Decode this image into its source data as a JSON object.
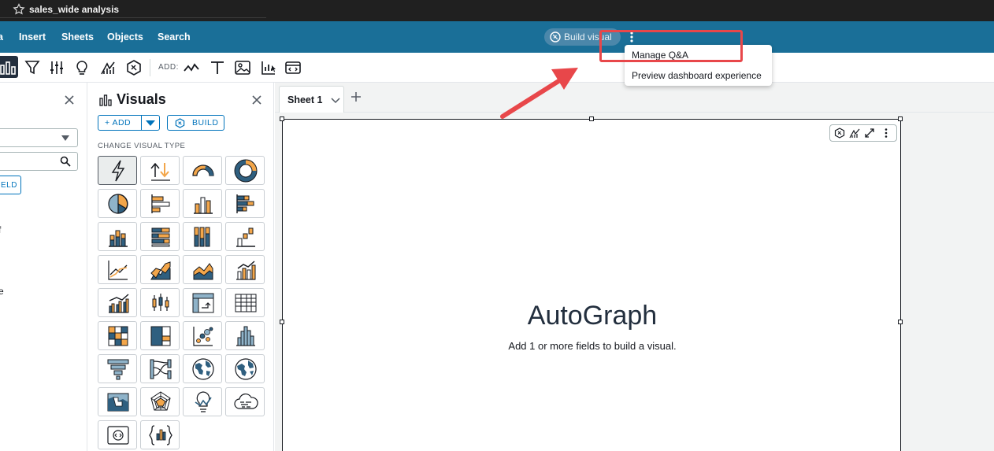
{
  "window": {
    "title": "sales_wide analysis"
  },
  "menubar": {
    "items": [
      {
        "label": "a"
      },
      {
        "label": "Insert"
      },
      {
        "label": "Sheets"
      },
      {
        "label": "Objects"
      },
      {
        "label": "Search"
      }
    ],
    "build_visual_label": "Build visual"
  },
  "toolbar": {
    "add_label": "ADD:"
  },
  "left_panel": {
    "field_button_label": "ELD",
    "fragments": [
      {
        "text": "f"
      },
      {
        "text": "e"
      }
    ]
  },
  "visuals_panel": {
    "title": "Visuals",
    "add_label": "+ ADD",
    "build_label": "BUILD",
    "section_label": "CHANGE VISUAL TYPE",
    "types": [
      "autograph-icon",
      "kpi-icon",
      "gauge-icon",
      "donut-icon",
      "pie-icon",
      "horizontal-bar-icon",
      "vertical-bar-icon",
      "stacked-horizontal-bar-icon",
      "stacked-vertical-bar-icon",
      "stacked-100-horizontal-bar-icon",
      "stacked-100-vertical-bar-icon",
      "waterfall-icon",
      "line-icon",
      "area-icon",
      "stacked-area-icon",
      "bar-line-combo-icon",
      "clustered-combo-icon",
      "box-plot-icon",
      "pivot-table-icon",
      "table-icon",
      "heat-map-icon",
      "tree-map-icon",
      "scatter-icon",
      "histogram-icon",
      "funnel-icon",
      "sankey-icon",
      "filled-map-icon",
      "points-map-icon",
      "geospatial-map-icon",
      "radar-icon",
      "insight-icon",
      "word-cloud-icon",
      "embed-icon",
      "custom-visual-icon"
    ],
    "selected_index": 0
  },
  "sheets": {
    "tabs": [
      {
        "label": "Sheet 1"
      }
    ]
  },
  "visual": {
    "title": "AutoGraph",
    "subtitle": "Add 1 or more fields to build a visual."
  },
  "dropdown": {
    "items": [
      {
        "label": "Manage Q&A"
      },
      {
        "label": "Preview dashboard experience"
      }
    ]
  },
  "colors": {
    "menubar": "#1a6f98",
    "accent": "#0073bb",
    "highlight": "#e8474a",
    "chart_orange": "#f3a64a",
    "chart_blue": "#2f5f7f"
  }
}
